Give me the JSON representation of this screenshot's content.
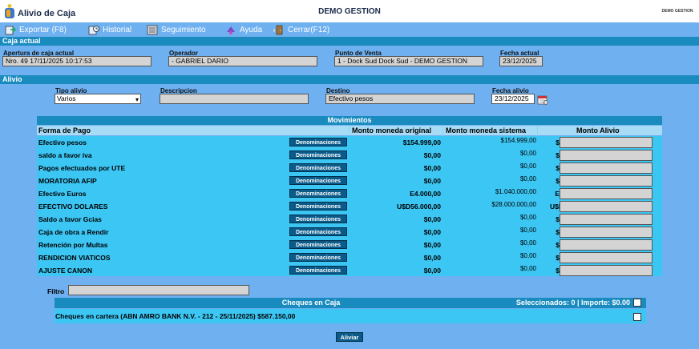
{
  "window": {
    "title": "Alivio de Caja",
    "company": "DEMO GESTION",
    "brand": "DEMO GESTION"
  },
  "menu": {
    "exportar": "Exportar (F8)",
    "historial": "Historial",
    "seguimiento": "Seguimiento",
    "ayuda": "Ayuda",
    "cerrar": "Cerrar(F12)"
  },
  "caja_actual": {
    "section": "Caja actual",
    "apertura_label": "Apertura de caja actual",
    "apertura_value": "Nro. 49  17/11/2025 10:17:53",
    "operador_label": "Operador",
    "operador_value": "- GABRIEL DARIO",
    "punto_label": "Punto de Venta",
    "punto_value": "1 - Dock Sud Dock Sud - DEMO GESTION",
    "fecha_label": "Fecha actual",
    "fecha_value": "23/12/2025"
  },
  "alivio": {
    "section": "Alivio",
    "tipo_label": "Tipo alivio",
    "tipo_value": "Varios",
    "descripcion_label": "Descripcion",
    "descripcion_value": "",
    "destino_label": "Destino",
    "destino_value": "Efectivo pesos",
    "fecha_label": "Fecha alivio",
    "fecha_value": "23/12/2025"
  },
  "movimientos": {
    "title": "Movimientos",
    "headers": {
      "forma": "Forma de Pago",
      "original": "Monto moneda original",
      "sistema": "Monto moneda sistema",
      "alivio": "Monto Alivio"
    },
    "denominaciones_label": "Denominaciones",
    "rows": [
      {
        "name": "Efectivo pesos",
        "original": "$154.999,00",
        "sistema": "$154.999,00",
        "currency": "$"
      },
      {
        "name": "saldo a favor iva",
        "original": "$0,00",
        "sistema": "$0,00",
        "currency": "$"
      },
      {
        "name": "Pagos efectuados por UTE",
        "original": "$0,00",
        "sistema": "$0,00",
        "currency": "$"
      },
      {
        "name": "MORATORIA AFIP",
        "original": "$0,00",
        "sistema": "$0,00",
        "currency": "$"
      },
      {
        "name": "Efectivo Euros",
        "original": "E4.000,00",
        "sistema": "$1.040.000,00",
        "currency": "E"
      },
      {
        "name": "EFECTIVO DOLARES",
        "original": "U$D56.000,00",
        "sistema": "$28.000.000,00",
        "currency": "U$D"
      },
      {
        "name": "Saldo a favor Gcias",
        "original": "$0,00",
        "sistema": "$0,00",
        "currency": "$"
      },
      {
        "name": "Caja de obra a Rendir",
        "original": "$0,00",
        "sistema": "$0,00",
        "currency": "$"
      },
      {
        "name": "Retención por Multas",
        "original": "$0,00",
        "sistema": "$0,00",
        "currency": "$"
      },
      {
        "name": "RENDICION VIATICOS",
        "original": "$0,00",
        "sistema": "$0,00",
        "currency": "$"
      },
      {
        "name": "AJUSTE CANON",
        "original": "$0,00",
        "sistema": "$0,00",
        "currency": "$"
      }
    ]
  },
  "filtro": {
    "label": "Filtro",
    "value": ""
  },
  "cheques": {
    "title": "Cheques en Caja",
    "seleccion": "Seleccionados: 0 | Importe: $0.00",
    "rows": [
      {
        "text": "Cheques en cartera (ABN AMRO BANK N.V. - 212 - 25/11/2025) $587.150,00"
      }
    ]
  },
  "actions": {
    "aliviar": "Aliviar"
  },
  "colors": {
    "background": "#6eb0f0",
    "section": "#1a8bbf",
    "rows": "#3cc6f4",
    "button": "#0a5a8a"
  }
}
